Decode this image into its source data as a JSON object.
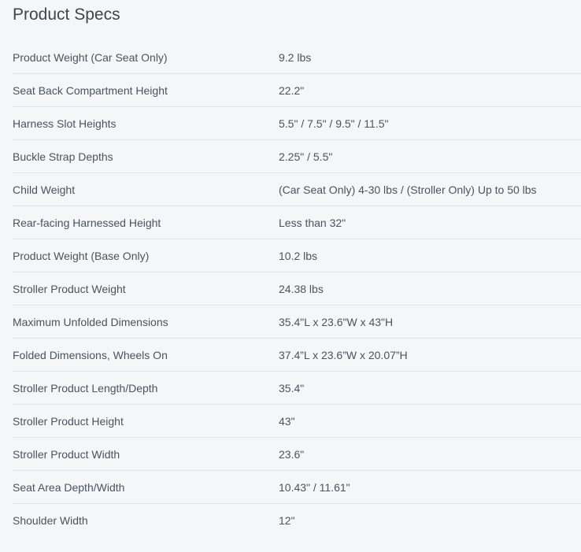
{
  "title": "Product Specs",
  "specs": [
    {
      "label": "Product Weight (Car Seat Only)",
      "value": "9.2 lbs"
    },
    {
      "label": "Seat Back Compartment Height",
      "value": "22.2\""
    },
    {
      "label": "Harness Slot Heights",
      "value": "5.5\" / 7.5\" / 9.5\" / 11.5\""
    },
    {
      "label": "Buckle Strap Depths",
      "value": "2.25\" / 5.5\""
    },
    {
      "label": "Child Weight",
      "value": "(Car Seat Only) 4-30 lbs / (Stroller Only) Up to 50 lbs"
    },
    {
      "label": "Rear-facing Harnessed Height",
      "value": "Less than 32\""
    },
    {
      "label": "Product Weight (Base Only)",
      "value": "10.2 lbs"
    },
    {
      "label": "Stroller Product Weight",
      "value": "24.38 lbs"
    },
    {
      "label": "Maximum Unfolded Dimensions",
      "value": "35.4\"L x 23.6\"W x 43\"H"
    },
    {
      "label": "Folded Dimensions, Wheels On",
      "value": "37.4”L x 23.6”W x 20.07”H"
    },
    {
      "label": "Stroller Product Length/Depth",
      "value": "35.4\""
    },
    {
      "label": "Stroller Product Height",
      "value": "43\""
    },
    {
      "label": "Stroller Product Width",
      "value": "23.6\""
    },
    {
      "label": "Seat Area Depth/Width",
      "value": "10.43\" / 11.61\""
    },
    {
      "label": "Shoulder Width",
      "value": "12\""
    }
  ]
}
